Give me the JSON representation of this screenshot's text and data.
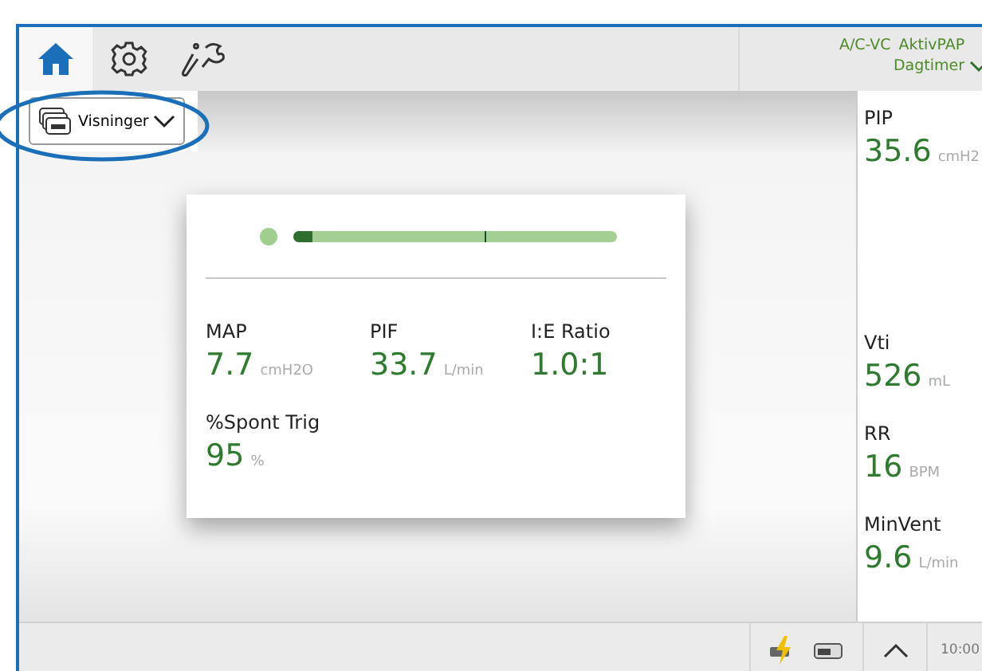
{
  "tabs": [
    {
      "kind": "home",
      "selected": true
    },
    {
      "kind": "settings",
      "selected": false
    },
    {
      "kind": "tools",
      "selected": false
    }
  ],
  "mode": {
    "labels": [
      "A/C-VC",
      "AktivPAP"
    ],
    "period": "Dagtimer"
  },
  "views_button": {
    "label": "Visninger"
  },
  "card": {
    "breath_bar": {
      "level": 0.06
    },
    "values": [
      {
        "name": "MAP",
        "value": "7.7",
        "unit": "cmH2O"
      },
      {
        "name": "PIF",
        "value": "33.7",
        "unit": "L/min"
      },
      {
        "name": "I:E Ratio",
        "value": "1.0:1"
      },
      {
        "name": "%Spont Trig",
        "value": "95",
        "unit": "%"
      }
    ]
  },
  "side_values": [
    {
      "name": "PIP",
      "value": "35.6",
      "unit": "cmH2"
    },
    {
      "name": "Vti",
      "value": "526",
      "unit": "mL"
    },
    {
      "name": "RR",
      "value": "16",
      "unit": "BPM"
    },
    {
      "name": "MinVent",
      "value": "9.6",
      "unit": "L/min"
    }
  ],
  "status_bar": {
    "time": "10:00"
  }
}
